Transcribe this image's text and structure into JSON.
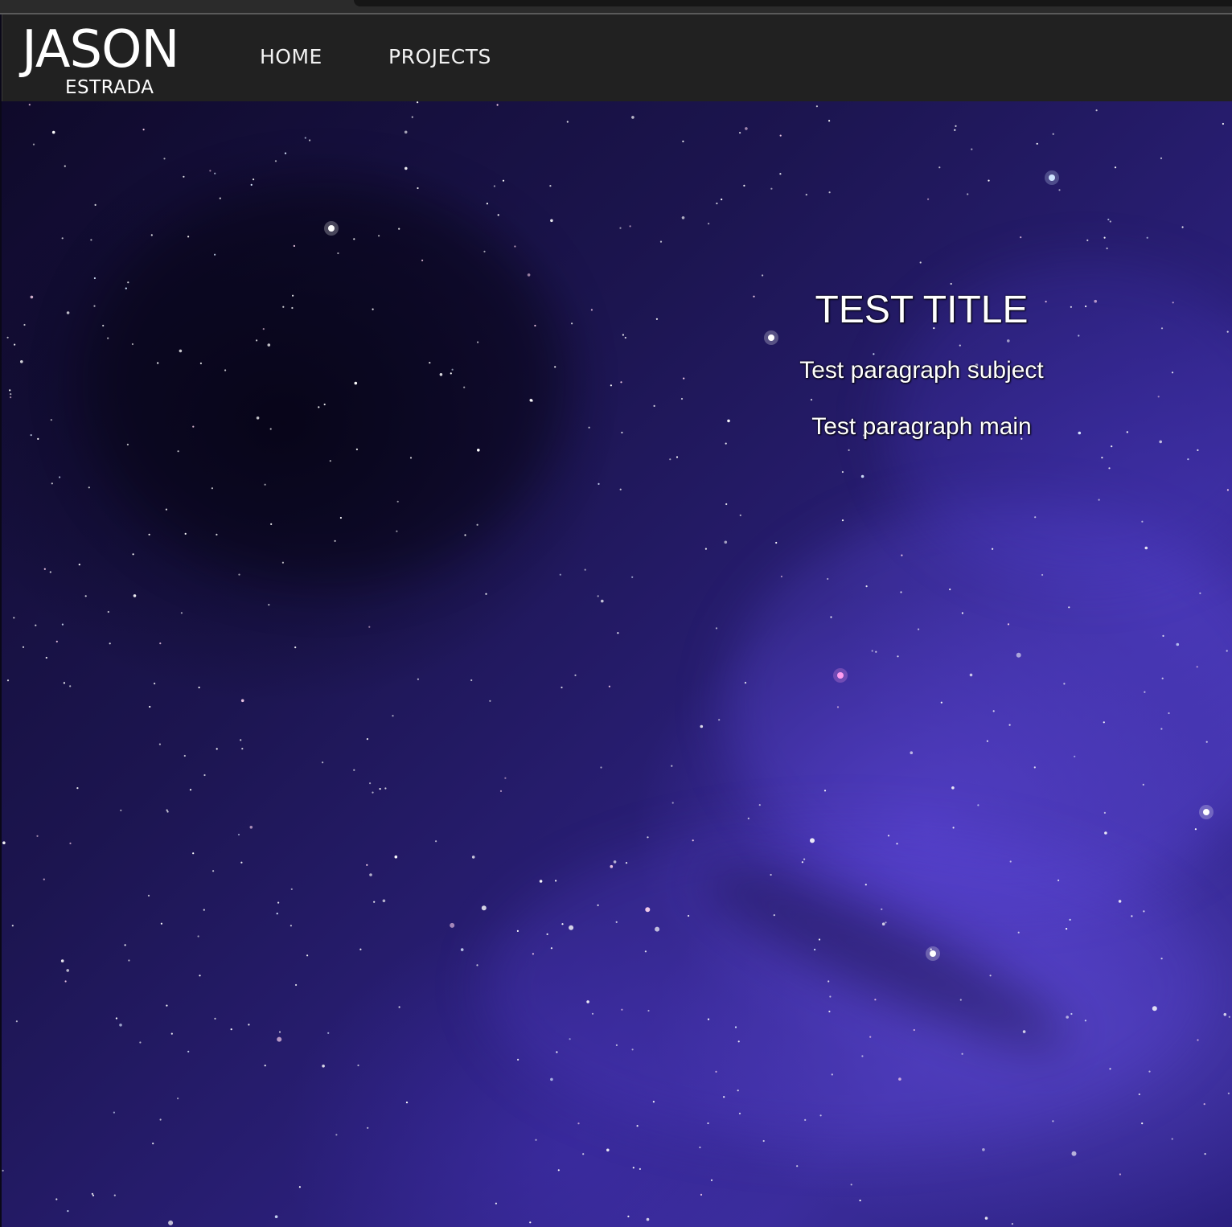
{
  "logo": {
    "first": "JASON",
    "last": "ESTRADA"
  },
  "nav": {
    "home": "HOME",
    "projects": "PROJECTS"
  },
  "hero": {
    "title": "TEST TITLE",
    "subject": "Test paragraph subject",
    "main": "Test paragraph main"
  },
  "colors": {
    "navbar": "#212121",
    "space_dark": "#0f0a2a",
    "space_purple": "#3a2c9a",
    "text": "#ffffff"
  }
}
